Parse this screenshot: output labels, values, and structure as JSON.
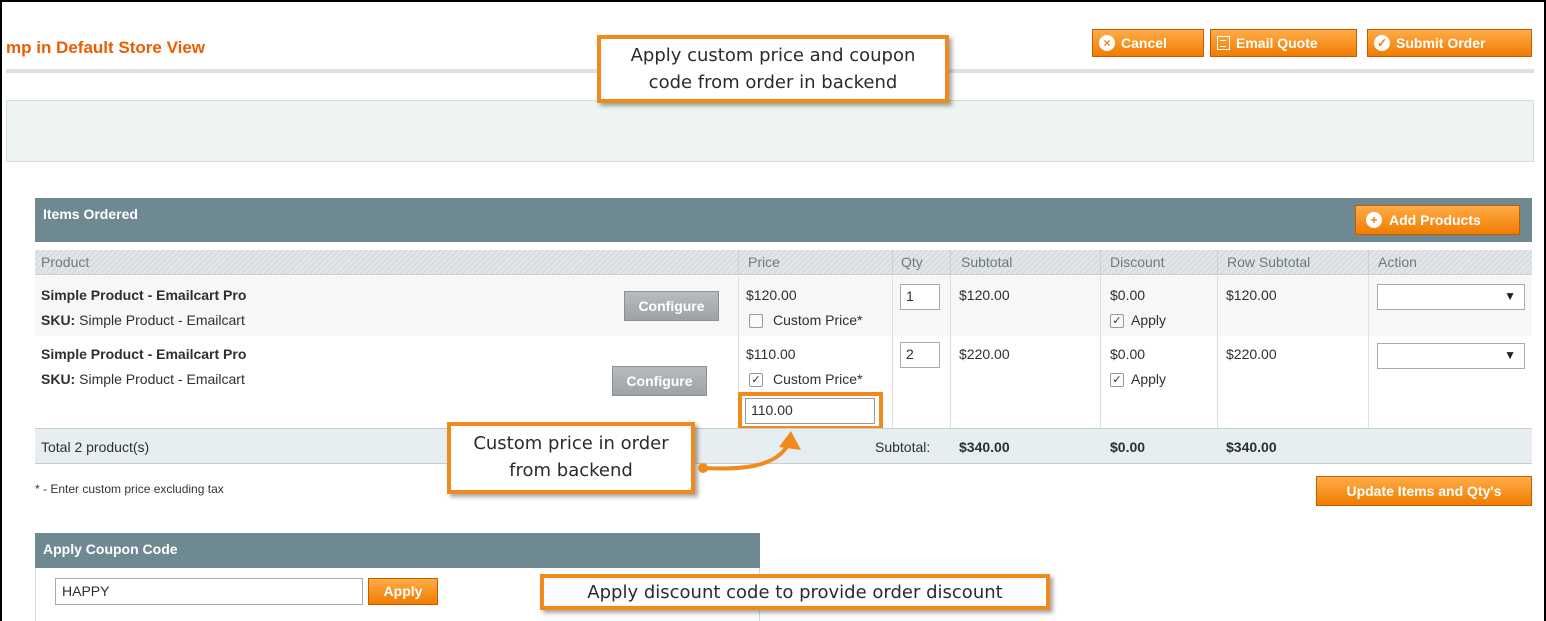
{
  "header": {
    "title": "mp in Default Store View",
    "buttons": [
      {
        "label": "Cancel",
        "icon": "cancel-circle-icon"
      },
      {
        "label": "Email Quote",
        "icon": "document-icon"
      },
      {
        "label": "Submit Order",
        "icon": "check-circle-icon"
      }
    ]
  },
  "annotations": {
    "top": [
      "Apply custom price and coupon",
      "code from order in backend"
    ],
    "price": [
      "Custom price in order",
      "from backend"
    ],
    "coupon": "Apply discount code to provide order discount"
  },
  "items_ordered": {
    "title": "Items Ordered",
    "add_products_label": "Add Products",
    "columns": [
      "Product",
      "Price",
      "Qty",
      "Subtotal",
      "Discount",
      "Row Subtotal",
      "Action"
    ],
    "configure_label": "Configure",
    "rows": [
      {
        "name": "Simple Product - Emailcart Pro",
        "sku_label": "SKU:",
        "sku": "Simple Product - Emailcart",
        "price": "$120.00",
        "custom_price_label": "Custom Price*",
        "custom_price_checked": false,
        "qty": "1",
        "subtotal": "$120.00",
        "discount": "$0.00",
        "apply_label": "Apply",
        "apply_checked": true,
        "row_subtotal": "$120.00"
      },
      {
        "name": "Simple Product - Emailcart Pro",
        "sku_label": "SKU:",
        "sku": "Simple Product - Emailcart",
        "price": "$110.00",
        "custom_price_label": "Custom Price*",
        "custom_price_checked": true,
        "custom_price_value": "110.00",
        "qty": "2",
        "subtotal": "$220.00",
        "discount": "$0.00",
        "apply_label": "Apply",
        "apply_checked": true,
        "row_subtotal": "$220.00"
      }
    ],
    "totals": {
      "products_label": "Total 2 product(s)",
      "subtotal_label": "Subtotal:",
      "subtotal": "$340.00",
      "discount": "$0.00",
      "row_subtotal": "$340.00"
    },
    "note": "* - Enter custom price excluding tax",
    "update_label": "Update Items and Qty's"
  },
  "coupon": {
    "title": "Apply Coupon Code",
    "value": "HAPPY",
    "apply_label": "Apply"
  },
  "colors": {
    "accent": "#f18200",
    "callout_border": "#f18a1c",
    "section_header": "#6f8992",
    "title": "#eb5e00"
  }
}
